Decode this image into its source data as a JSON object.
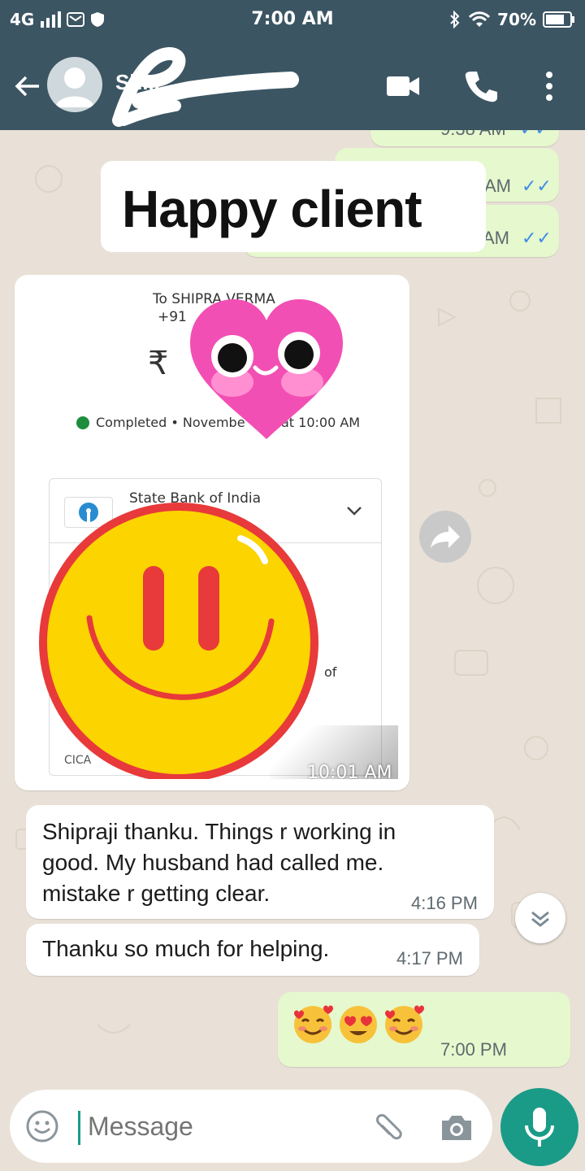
{
  "status_bar": {
    "network": "4G",
    "roaming": "R",
    "time": "7:00 AM",
    "battery": "70%"
  },
  "header": {
    "contact_name": "Sh...",
    "icons": [
      "back-arrow",
      "avatar",
      "video-call",
      "voice-call",
      "more-vert"
    ]
  },
  "overlay_label": "Happy client",
  "messages": [
    {
      "dir": "out",
      "partial_time": "9:38 AM",
      "ticks": "✓✓"
    },
    {
      "dir": "out",
      "partial_time": "AM",
      "ticks": "✓✓"
    },
    {
      "dir": "out",
      "partial_time": "AM",
      "ticks": "✓✓"
    },
    {
      "dir": "in",
      "type": "image",
      "time": "10:01 AM",
      "receipt": {
        "to": "To SHIPRA VERMA",
        "phone": "+91",
        "amount": "₹",
        "status": "Completed • Novembe",
        "status_time": "at 10:00 AM",
        "bank": "State Bank of India",
        "of": "of",
        "cica": "CICA"
      }
    },
    {
      "dir": "in",
      "text_lines": [
        "Shipraji thanku. Things r working in",
        "good. My husband had called me.",
        "mistake r getting clear."
      ],
      "time": "4:16 PM"
    },
    {
      "dir": "in",
      "text": "Thanku so much for helping.",
      "time": "4:17 PM"
    },
    {
      "dir": "out",
      "emojis": [
        "🥰",
        "😍",
        "🥰"
      ],
      "time": "7:00 PM"
    }
  ],
  "composer": {
    "placeholder": "Message"
  },
  "colors": {
    "header": "#3c5563",
    "wallpaper": "#e9e1d7",
    "out_bubble": "#e6f8cd",
    "in_bubble": "#ffffff",
    "accent": "#1a9b87",
    "tick_blue": "#3d8de8"
  }
}
